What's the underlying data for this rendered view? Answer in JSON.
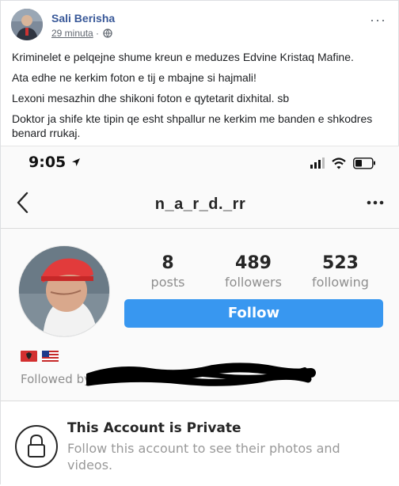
{
  "post": {
    "author": "Sali Berisha",
    "time": "29 minuta",
    "separator": "·",
    "lines": [
      "Kriminelet e pelqejne shume kreun e meduzes Edvine Kristaq Mafine.",
      "Ata edhe ne kerkim foton e tij e mbajne si hajmali!",
      "Lexoni mesazhin dhe shikoni foton e qytetarit dixhital. sb",
      "Doktor ja shife kte tipin qe esht shpallur ne kerkim me banden e shkodres benard rrukaj."
    ]
  },
  "phone": {
    "time": "9:05"
  },
  "instagram": {
    "username": "n_a_r_d._rr",
    "stats": [
      {
        "num": "8",
        "label": "posts"
      },
      {
        "num": "489",
        "label": "followers"
      },
      {
        "num": "523",
        "label": "following"
      }
    ],
    "follow_label": "Follow",
    "followed_by_label": "Followed by",
    "private_title": "This Account is Private",
    "private_sub": "Follow this account to see their photos and videos."
  },
  "icons": {
    "globe": "globe-icon",
    "back": "chevron-left-icon",
    "more": "more-dots-icon",
    "lock": "lock-icon",
    "signal": "signal-icon",
    "wifi": "wifi-icon",
    "battery": "battery-icon",
    "location": "location-arrow-icon"
  },
  "colors": {
    "author": "#385898",
    "follow_button": "#3897f0",
    "muted": "#8e8e8e"
  }
}
